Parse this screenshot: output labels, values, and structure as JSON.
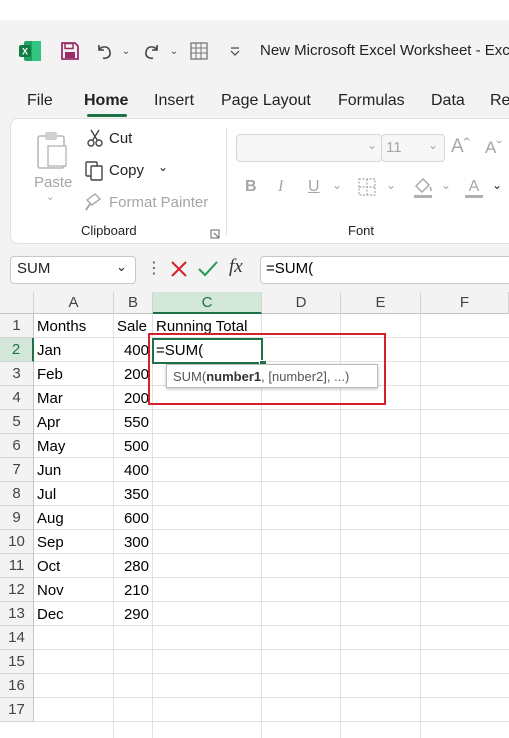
{
  "titlebar": {
    "doc_title": "New Microsoft Excel Worksheet  -  Exc"
  },
  "tabs": [
    "File",
    "Home",
    "Insert",
    "Page Layout",
    "Formulas",
    "Data",
    "Re"
  ],
  "active_tab": "Home",
  "ribbon": {
    "paste_label": "Paste",
    "cut_label": "Cut",
    "copy_label": "Copy",
    "format_painter_label": "Format Painter",
    "clipboard_group": "Clipboard",
    "font_group": "Font",
    "font_size": "11",
    "bold": "B",
    "italic": "I",
    "underline": "U",
    "grow_font": "Aˆ",
    "shrink_font": "Aˇ"
  },
  "formula_bar": {
    "name_box": "SUM",
    "fx": "fx",
    "formula": "=SUM("
  },
  "grid": {
    "columns": [
      "A",
      "B",
      "C",
      "D",
      "E",
      "F"
    ],
    "rows": [
      "1",
      "2",
      "3",
      "4",
      "5",
      "6",
      "7",
      "8",
      "9",
      "10",
      "11",
      "12",
      "13",
      "14",
      "15",
      "16",
      "17"
    ],
    "header_row": {
      "a": "Months",
      "b": "Sale",
      "c": "Running Total"
    },
    "data": [
      {
        "month": "Jan",
        "sale": "400"
      },
      {
        "month": "Feb",
        "sale": "200"
      },
      {
        "month": "Mar",
        "sale": "200"
      },
      {
        "month": "Apr",
        "sale": "550"
      },
      {
        "month": "May",
        "sale": "500"
      },
      {
        "month": "Jun",
        "sale": "400"
      },
      {
        "month": "Jul",
        "sale": "350"
      },
      {
        "month": "Aug",
        "sale": "600"
      },
      {
        "month": "Sep",
        "sale": "300"
      },
      {
        "month": "Oct",
        "sale": "280"
      },
      {
        "month": "Nov",
        "sale": "210"
      },
      {
        "month": "Dec",
        "sale": "290"
      }
    ],
    "active_cell_text": "=SUM(",
    "tooltip": {
      "fn": "SUM(",
      "arg1": "number1",
      "rest": ", [number2], ...)"
    }
  },
  "colors": {
    "accent": "#1e7145",
    "highlight": "#d4202c"
  }
}
